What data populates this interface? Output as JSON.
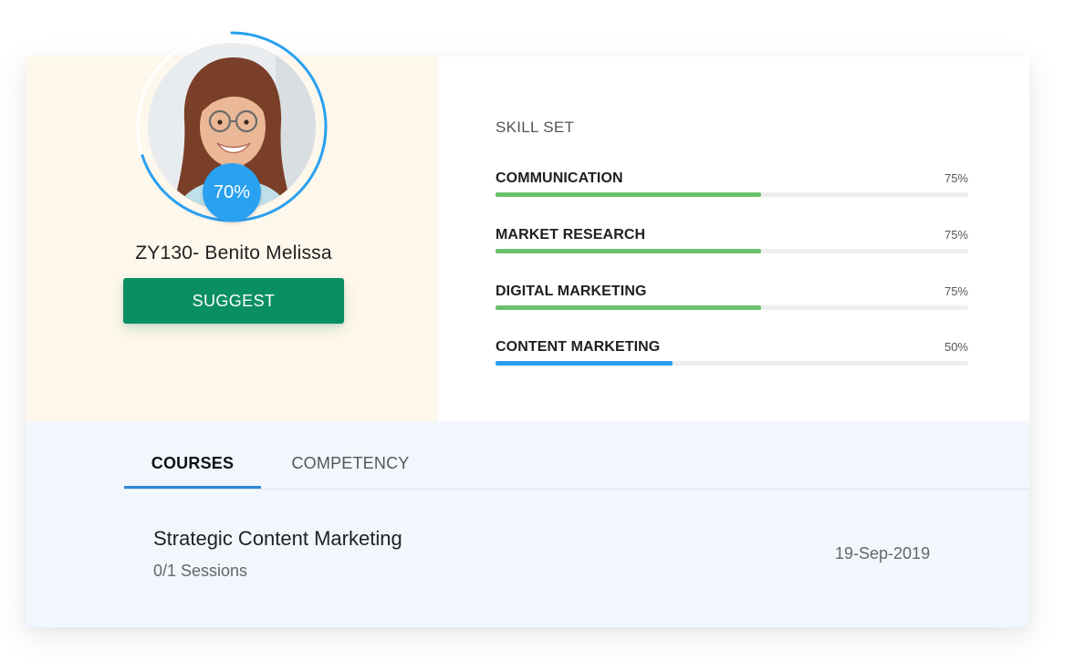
{
  "profile": {
    "score_label": "70%",
    "score_fraction": 0.7,
    "employee_name": "ZY130- Benito Melissa",
    "suggest_label": "SUGGEST"
  },
  "skills": {
    "title": "SKILL SET",
    "items": [
      {
        "name": "COMMUNICATION",
        "percent_label": "75%",
        "value": 75,
        "color": "#6cc06a"
      },
      {
        "name": "MARKET RESEARCH",
        "percent_label": "75%",
        "value": 75,
        "color": "#6cc06a"
      },
      {
        "name": "DIGITAL MARKETING",
        "percent_label": "75%",
        "value": 75,
        "color": "#6cc06a"
      },
      {
        "name": "CONTENT MARKETING",
        "percent_label": "50%",
        "value": 50,
        "color": "#2aa0f0"
      }
    ]
  },
  "tabs": [
    {
      "label": "COURSES",
      "active": true
    },
    {
      "label": "COMPETENCY",
      "active": false
    }
  ],
  "course": {
    "title": "Strategic Content Marketing",
    "sessions": "0/1 Sessions",
    "date": "19-Sep-2019"
  },
  "colors": {
    "left_panel_bg": "#fef7eb",
    "bottom_panel_bg": "#f1f7fd",
    "accent_blue": "#2aa0f0",
    "suggest_green": "#0a8f62",
    "skill_green": "#6cc06a"
  }
}
